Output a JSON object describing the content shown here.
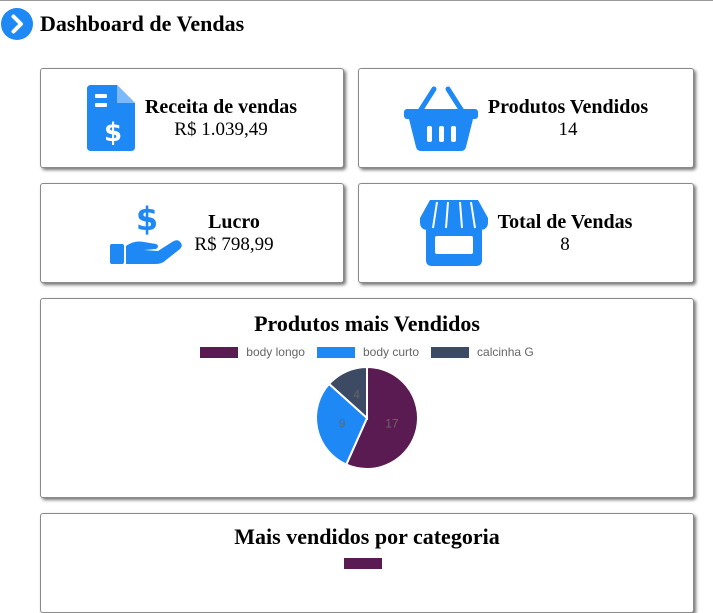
{
  "header": {
    "title": "Dashboard de Vendas",
    "icon": "chevron-right-circle-icon"
  },
  "cards": {
    "revenue": {
      "label": "Receita de vendas",
      "value": "R$ 1.039,49",
      "icon": "invoice-dollar-icon"
    },
    "products": {
      "label": "Produtos Vendidos",
      "value": "14",
      "icon": "shopping-basket-icon"
    },
    "profit": {
      "label": "Lucro",
      "value": "R$ 798,99",
      "icon": "hand-dollar-icon"
    },
    "sales": {
      "label": "Total de Vendas",
      "value": "8",
      "icon": "store-icon"
    }
  },
  "colors": {
    "accent": "#1e88f5"
  },
  "chart_data": [
    {
      "type": "pie",
      "title": "Produtos mais Vendidos",
      "categories": [
        "body longo",
        "body curto",
        "calcinha G"
      ],
      "values": [
        17,
        9,
        4
      ],
      "colors": [
        "#5a1a52",
        "#1e88f5",
        "#3c4a63"
      ],
      "legend": "top"
    },
    {
      "type": "bar",
      "title": "Mais vendidos por categoria",
      "categories": [],
      "series": [
        {
          "values": [],
          "color": "#5a1a52"
        }
      ],
      "legend": "top"
    }
  ]
}
